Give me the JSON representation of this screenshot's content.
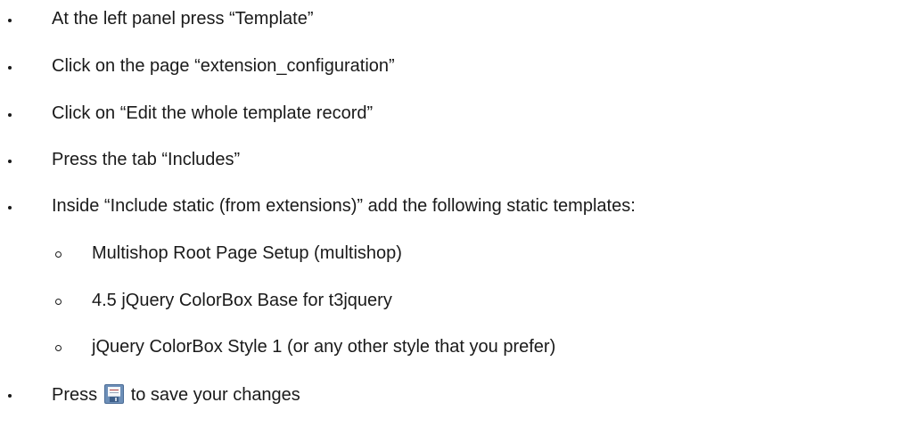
{
  "steps": [
    {
      "text": "At the left panel press “Template”"
    },
    {
      "text": "Click on the page “extension_configuration”"
    },
    {
      "text": "Click on “Edit the whole template record”"
    },
    {
      "text": "Press the tab “Includes”"
    },
    {
      "text": "Inside “Include static (from extensions)” add the following static templates:"
    },
    {
      "text": "Multishop Root Page Setup (multishop)"
    },
    {
      "text": "4.5 jQuery ColorBox Base for t3jquery"
    },
    {
      "text": "jQuery ColorBox Style 1 (or any other style that you prefer)"
    },
    {
      "text_before_icon": "Press",
      "icon": "save-icon",
      "text_after_icon": "to save your changes"
    }
  ]
}
